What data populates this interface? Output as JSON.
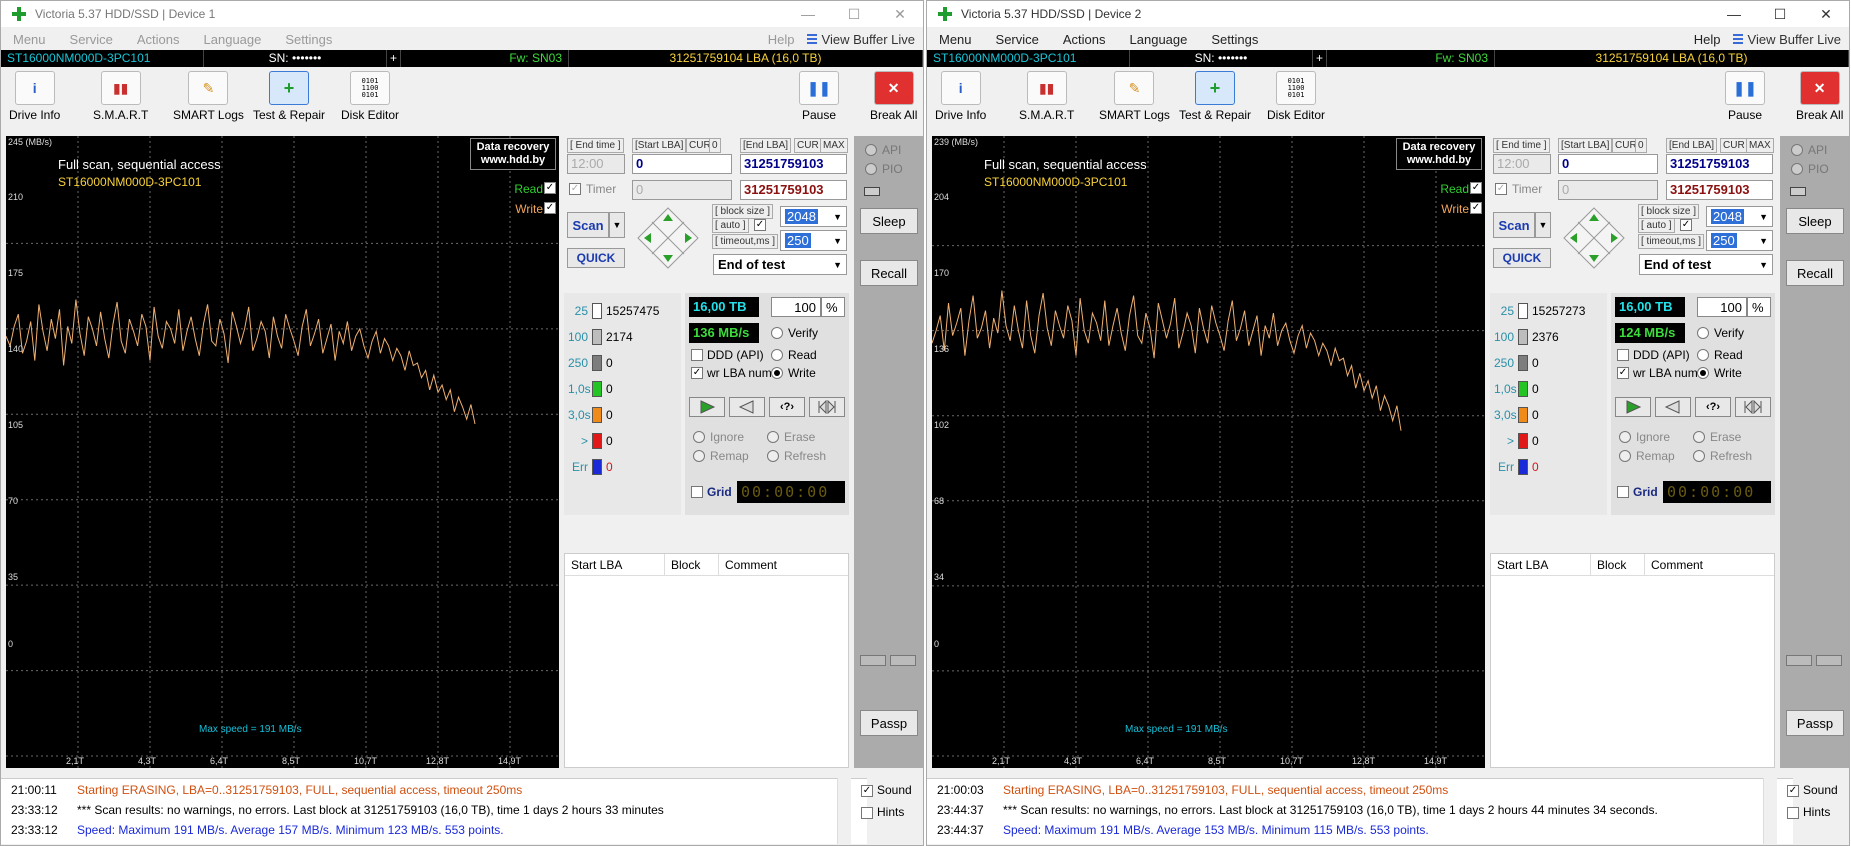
{
  "windows": [
    {
      "title": "Victoria 5.37 HDD/SSD | Device 1",
      "active": false,
      "menu": [
        "Menu",
        "Service",
        "Actions",
        "Language",
        "Settings",
        "Help"
      ],
      "view_buffer": "View Buffer Live",
      "info": {
        "model": "ST16000NM000D-3PC101",
        "sn": "SN: •••••••",
        "plus": "+",
        "fw": "Fw: SN03",
        "lba": "31251759104 LBA (16,0 TB)"
      },
      "toolbar": [
        "Drive Info",
        "S.M.A.R.T",
        "SMART Logs",
        "Test & Repair",
        "Disk Editor"
      ],
      "pause": "Pause",
      "break_all": "Break All",
      "graph": {
        "unit": "245 (MB/s)",
        "mode": "Full scan, sequential access",
        "model": "ST16000NM000D-3PC101",
        "recovery_line1": "Data recovery",
        "recovery_line2": "www.hdd.by",
        "read": "Read",
        "write": "Write",
        "max_speed": "Max speed = 191 MB/s",
        "yticks": [
          "210",
          "175",
          "140",
          "105",
          "70",
          "35",
          "0"
        ],
        "xticks": [
          "2,1T",
          "4,3T",
          "6,4T",
          "8,5T",
          "10,7T",
          "12,8T",
          "14,9T"
        ]
      },
      "panel": {
        "end_time_lbl": "[ End time ]",
        "start_lba_lbl": "[Start LBA]",
        "cur": "CUR",
        "zero": "0",
        "end_lba_lbl": "[End LBA]",
        "max": "MAX",
        "end_time": "12:00",
        "start_lba": "0",
        "end_lba": "31251759103",
        "timer": "Timer",
        "timer_val": "0",
        "end_lba2": "31251759103",
        "scan": "Scan",
        "quick": "QUICK",
        "block_size_lbl": "[ block size ]",
        "auto_lbl": "[ auto ]",
        "timeout_lbl": "[ timeout,ms ]",
        "block_size": "2048",
        "timeout": "250",
        "end_of_test": "End of test",
        "counts": [
          {
            "label": "25",
            "value": "15257475",
            "color": "#ffffff"
          },
          {
            "label": "100",
            "value": "2174",
            "color": "#bdbdbd"
          },
          {
            "label": "250",
            "value": "0",
            "color": "#7d7d7d"
          },
          {
            "label": "1,0s",
            "value": "0",
            "color": "#25c425"
          },
          {
            "label": "3,0s",
            "value": "0",
            "color": "#f08a18"
          },
          {
            "label": ">",
            "value": "0",
            "color": "#e01818"
          },
          {
            "label": "Err",
            "value": "0",
            "color": "#1a2ad8"
          }
        ],
        "capacity": "16,00 TB",
        "percent": "100",
        "pct": "%",
        "speed": "136 MB/s",
        "verify": "Verify",
        "read": "Read",
        "write": "Write",
        "ddd": "DDD (API)",
        "wr_lba": "wr LBA num",
        "ignore": "Ignore",
        "erase": "Erase",
        "remap": "Remap",
        "refresh": "Refresh",
        "grid": "Grid",
        "timer_lcd": "00:00:00",
        "table_headers": [
          "Start LBA",
          "Block",
          "Comment"
        ]
      },
      "side": {
        "api": "API",
        "pio": "PIO",
        "sleep": "Sleep",
        "recall": "Recall",
        "passp": "Passp"
      },
      "log": [
        {
          "time": "21:00:11",
          "text": "Starting ERASING, LBA=0..31251759103, FULL, sequential access, timeout 250ms",
          "color": "#d05010"
        },
        {
          "time": "23:33:12",
          "text": "*** Scan results: no warnings, no errors. Last block at 31251759103 (16,0 TB), time 1 days 2 hours 33 minutes",
          "color": "#000000"
        },
        {
          "time": "23:33:12",
          "text": "Speed: Maximum 191 MB/s. Average 157 MB/s. Minimum 123 MB/s. 553 points.",
          "color": "#1a2ad8"
        }
      ],
      "sound": "Sound",
      "hints": "Hints",
      "speed_profile": [
        172,
        168,
        176,
        181,
        165,
        170,
        178,
        162,
        185,
        174,
        166,
        179,
        171,
        183,
        160,
        176,
        169,
        187,
        173,
        164,
        180,
        175,
        168,
        182,
        171,
        163,
        177,
        186,
        170,
        165,
        179,
        174,
        168,
        181,
        176,
        162,
        184,
        172,
        167,
        178,
        175,
        169,
        183,
        166,
        174,
        180,
        171,
        164,
        177,
        185,
        170,
        168,
        179,
        173,
        161,
        182,
        176,
        169,
        175,
        184,
        166,
        171,
        178,
        174,
        163,
        180,
        172,
        167,
        181,
        175,
        170,
        164,
        176,
        183,
        168,
        173,
        179,
        165,
        171,
        177,
        162,
        174,
        169,
        178,
        166,
        172,
        175,
        168,
        163,
        170,
        174,
        165,
        171,
        168,
        162,
        167,
        164,
        158,
        166,
        160,
        161,
        155,
        158,
        150,
        156,
        149,
        152,
        146,
        150,
        141,
        147,
        143,
        138,
        144,
        136
      ]
    },
    {
      "title": "Victoria 5.37 HDD/SSD | Device 2",
      "active": true,
      "menu": [
        "Menu",
        "Service",
        "Actions",
        "Language",
        "Settings",
        "Help"
      ],
      "view_buffer": "View Buffer Live",
      "info": {
        "model": "ST16000NM000D-3PC101",
        "sn": "SN: •••••••",
        "plus": "+",
        "fw": "Fw: SN03",
        "lba": "31251759104 LBA (16,0 TB)"
      },
      "toolbar": [
        "Drive Info",
        "S.M.A.R.T",
        "SMART Logs",
        "Test & Repair",
        "Disk Editor"
      ],
      "pause": "Pause",
      "break_all": "Break All",
      "graph": {
        "unit": "239 (MB/s)",
        "mode": "Full scan, sequential access",
        "model": "ST16000NM000D-3PC101",
        "recovery_line1": "Data recovery",
        "recovery_line2": "www.hdd.by",
        "read": "Read",
        "write": "Write",
        "max_speed": "Max speed = 191 MB/s",
        "yticks": [
          "204",
          "170",
          "136",
          "102",
          "68",
          "34",
          "0"
        ],
        "xticks": [
          "2,1T",
          "4,3T",
          "6,4T",
          "8,5T",
          "10,7T",
          "12,8T",
          "14,9T"
        ]
      },
      "panel": {
        "end_time_lbl": "[ End time ]",
        "start_lba_lbl": "[Start LBA]",
        "cur": "CUR",
        "zero": "0",
        "end_lba_lbl": "[End LBA]",
        "max": "MAX",
        "end_time": "12:00",
        "start_lba": "0",
        "end_lba": "31251759103",
        "timer": "Timer",
        "timer_val": "0",
        "end_lba2": "31251759103",
        "scan": "Scan",
        "quick": "QUICK",
        "block_size_lbl": "[ block size ]",
        "auto_lbl": "[ auto ]",
        "timeout_lbl": "[ timeout,ms ]",
        "block_size": "2048",
        "timeout": "250",
        "end_of_test": "End of test",
        "counts": [
          {
            "label": "25",
            "value": "15257273",
            "color": "#ffffff"
          },
          {
            "label": "100",
            "value": "2376",
            "color": "#bdbdbd"
          },
          {
            "label": "250",
            "value": "0",
            "color": "#7d7d7d"
          },
          {
            "label": "1,0s",
            "value": "0",
            "color": "#25c425"
          },
          {
            "label": "3,0s",
            "value": "0",
            "color": "#f08a18"
          },
          {
            "label": ">",
            "value": "0",
            "color": "#e01818"
          },
          {
            "label": "Err",
            "value": "0",
            "color": "#1a2ad8"
          }
        ],
        "capacity": "16,00 TB",
        "percent": "100",
        "pct": "%",
        "speed": "124 MB/s",
        "verify": "Verify",
        "read": "Read",
        "write": "Write",
        "ddd": "DDD (API)",
        "wr_lba": "wr LBA num",
        "ignore": "Ignore",
        "erase": "Erase",
        "remap": "Remap",
        "refresh": "Refresh",
        "grid": "Grid",
        "timer_lcd": "00:00:00",
        "table_headers": [
          "Start LBA",
          "Block",
          "Comment"
        ]
      },
      "side": {
        "api": "API",
        "pio": "PIO",
        "sleep": "Sleep",
        "recall": "Recall",
        "passp": "Passp"
      },
      "log": [
        {
          "time": "21:00:03",
          "text": "Starting ERASING, LBA=0..31251759103, FULL, sequential access, timeout 250ms",
          "color": "#d05010"
        },
        {
          "time": "23:44:37",
          "text": "*** Scan results: no warnings, no errors. Last block at 31251759103 (16,0 TB), time 1 days 2 hours 44 minutes 34 seconds.",
          "color": "#000000"
        },
        {
          "time": "23:44:37",
          "text": "Speed: Maximum 191 MB/s. Average 153 MB/s. Minimum 115 MB/s. 553 points.",
          "color": "#1a2ad8"
        }
      ],
      "sound": "Sound",
      "hints": "Hints",
      "speed_profile": [
        165,
        170,
        176,
        162,
        181,
        168,
        173,
        179,
        160,
        174,
        184,
        167,
        171,
        178,
        163,
        175,
        169,
        186,
        172,
        166,
        180,
        170,
        163,
        182,
        168,
        161,
        176,
        185,
        171,
        164,
        178,
        172,
        167,
        180,
        174,
        160,
        183,
        170,
        165,
        177,
        173,
        166,
        182,
        164,
        172,
        179,
        169,
        162,
        176,
        184,
        168,
        165,
        177,
        171,
        159,
        181,
        174,
        167,
        173,
        183,
        163,
        169,
        177,
        172,
        161,
        179,
        171,
        165,
        180,
        173,
        168,
        162,
        174,
        182,
        166,
        171,
        178,
        164,
        170,
        176,
        160,
        172,
        167,
        177,
        164,
        170,
        173,
        166,
        161,
        168,
        172,
        163,
        169,
        166,
        160,
        165,
        162,
        156,
        163,
        158,
        159,
        152,
        156,
        147,
        153,
        146,
        150,
        143,
        148,
        138,
        144,
        140,
        134,
        140,
        130
      ]
    }
  ]
}
